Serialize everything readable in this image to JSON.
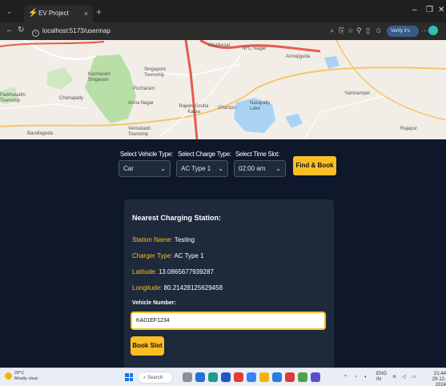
{
  "browser": {
    "tab_title": "EV Project",
    "tab_close": "×",
    "new_tab": "+",
    "url": "localhost:5173/usermap",
    "profile_label": "Verify it's you",
    "window_controls": [
      "–",
      "❐",
      "✕"
    ]
  },
  "map": {
    "labels": [
      "Ghatkesar",
      "NFC Nagar",
      "Annojiguda",
      "Singapore Township",
      "Pocharam",
      "Cherlapally",
      "Anna Nagar",
      "Rajeev Gruha Kalpa",
      "Venkatadri Township",
      "Bandlaguda",
      "Narapally Lake",
      "Ghanpur",
      "Yamnampet",
      "Rajapur",
      "Padmavathi Township",
      "Kachavani Singaram",
      "Nanadi",
      "Ghatkesar Rd"
    ],
    "colors": {
      "water": "#a9d3f5",
      "park": "#b8dfa6",
      "major_road": "#e85b4a",
      "minor_road": "#f5c66a",
      "land": "#f2eee7"
    }
  },
  "form": {
    "vehicle_type": {
      "label": "Select Vehicle Type:",
      "value": "Car"
    },
    "charge_type": {
      "label": "Select Charge Type:",
      "value": "AC Type 1"
    },
    "time_slot": {
      "label": "Select Time Slot:",
      "value": "02:00 am"
    },
    "find_book_label": "Find & Book"
  },
  "station": {
    "title": "Nearest Charging Station:",
    "name_key": "Station Name:",
    "name_value": "Testing",
    "charger_key": "Charger Type:",
    "charger_value": "AC Type 1",
    "lat_key": "Latitude:",
    "lat_value": "13.0865677939287",
    "lng_key": "Longitude:",
    "lng_value": "80.21428125629458",
    "vehicle_number_label": "Vehicle Number:",
    "vehicle_number_value": "KA01EF1234",
    "book_slot_label": "Book Slot"
  },
  "taskbar": {
    "weather_temp": "29°C",
    "weather_desc": "Mostly clear",
    "search_label": "Search",
    "lang": "ENG",
    "region": "IN",
    "time": "21:44",
    "date": "29-12-2024"
  },
  "colors": {
    "accent": "#fbbf24",
    "app_bg": "#0f172a",
    "card_bg": "#1e293b"
  }
}
